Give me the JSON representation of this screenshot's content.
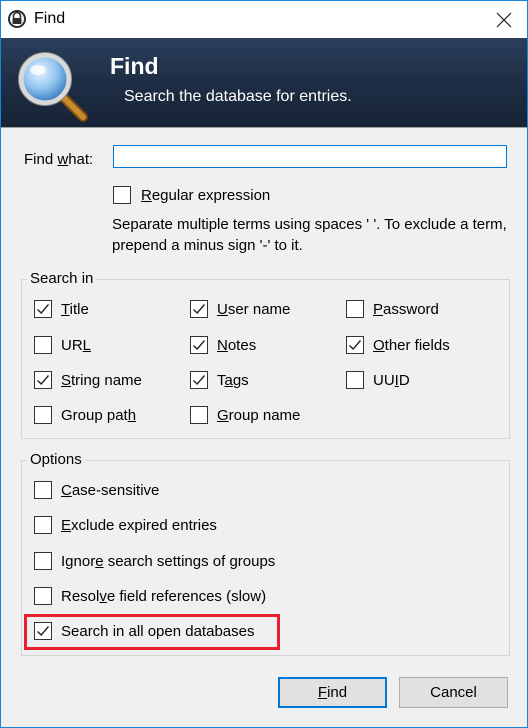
{
  "window": {
    "title": "Find",
    "close_icon": "close-icon",
    "app_icon": "keepass-lock-icon"
  },
  "banner": {
    "title": "Find",
    "subtitle": "Search the database for entries.",
    "icon": "magnifier-icon"
  },
  "find_what": {
    "label_pre": "Find ",
    "label_u": "w",
    "label_post": "hat:",
    "value": ""
  },
  "regex": {
    "label_u": "R",
    "label_rest": "egular expression",
    "checked": false
  },
  "hint": "Separate multiple terms using spaces ' '. To exclude a term, prepend a minus sign '-' to it.",
  "search_in": {
    "title": "Search in",
    "items": [
      {
        "pre": "",
        "u": "T",
        "post": "itle",
        "checked": true
      },
      {
        "pre": "",
        "u": "U",
        "post": "ser name",
        "checked": true
      },
      {
        "pre": "",
        "u": "P",
        "post": "assword",
        "checked": false
      },
      {
        "pre": "UR",
        "u": "L",
        "post": "",
        "checked": false
      },
      {
        "pre": "",
        "u": "N",
        "post": "otes",
        "checked": true
      },
      {
        "pre": "",
        "u": "O",
        "post": "ther fields",
        "checked": true
      },
      {
        "pre": "",
        "u": "S",
        "post": "tring name",
        "checked": true
      },
      {
        "pre": "T",
        "u": "a",
        "post": "gs",
        "checked": true
      },
      {
        "pre": "UU",
        "u": "I",
        "post": "D",
        "checked": false
      },
      {
        "pre": "Group pat",
        "u": "h",
        "post": "",
        "checked": false
      },
      {
        "pre": "",
        "u": "G",
        "post": "roup name",
        "checked": false
      }
    ]
  },
  "options": {
    "title": "Options",
    "items": [
      {
        "pre": "",
        "u": "C",
        "post": "ase-sensitive",
        "checked": false
      },
      {
        "pre": "",
        "u": "E",
        "post": "xclude expired entries",
        "checked": false
      },
      {
        "pre": "Ignor",
        "u": "e",
        "post": " search settings of groups",
        "checked": false
      },
      {
        "pre": "Resol",
        "u": "v",
        "post": "e field references (slow)",
        "checked": false
      },
      {
        "pre": "Search in all open databases",
        "u": "",
        "post": "",
        "checked": true
      }
    ]
  },
  "buttons": {
    "find": {
      "pre": "",
      "u": "F",
      "post": "ind"
    },
    "cancel": "Cancel"
  },
  "colors": {
    "accent": "#0078d7",
    "highlight": "#e8202d",
    "banner": "#1f2f46"
  }
}
